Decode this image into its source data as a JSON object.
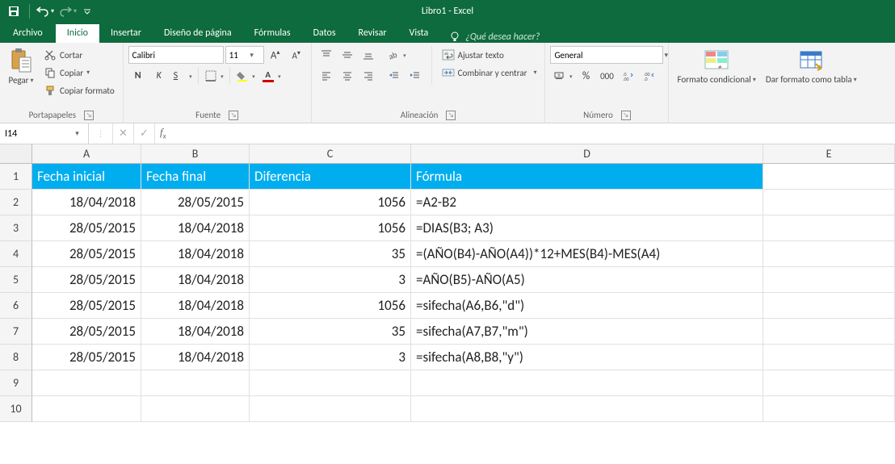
{
  "titlebar": {
    "title": "Libro1 - Excel"
  },
  "tabs": {
    "file": "Archivo",
    "items": [
      "Inicio",
      "Insertar",
      "Diseño de página",
      "Fórmulas",
      "Datos",
      "Revisar",
      "Vista"
    ],
    "active": 0,
    "tellme_placeholder": "¿Qué desea hacer?"
  },
  "ribbon": {
    "clipboard": {
      "label": "Portapapeles",
      "paste": "Pegar",
      "cut": "Cortar",
      "copy": "Copiar",
      "format_painter": "Copiar formato"
    },
    "font": {
      "label": "Fuente",
      "name": "Calibri",
      "size": "11",
      "bold": "N",
      "italic": "K",
      "underline": "S"
    },
    "alignment": {
      "label": "Alineación",
      "wrap": "Ajustar texto",
      "merge": "Combinar y centrar"
    },
    "number": {
      "label": "Número",
      "format": "General"
    },
    "styles": {
      "conditional": "Formato condicional",
      "table": "Dar formato como tabla"
    }
  },
  "namebox": {
    "value": "I14"
  },
  "sheet": {
    "columns": [
      "A",
      "B",
      "C",
      "D",
      "E"
    ],
    "header_row": [
      "Fecha inicial",
      "Fecha final",
      "Diferencia",
      "Fórmula",
      ""
    ],
    "rows": [
      {
        "n": "2",
        "A": "18/04/2018",
        "B": "28/05/2015",
        "C": "1056",
        "D": "=A2-B2"
      },
      {
        "n": "3",
        "A": "28/05/2015",
        "B": "18/04/2018",
        "C": "1056",
        "D": "=DIAS(B3; A3)"
      },
      {
        "n": "4",
        "A": "28/05/2015",
        "B": "18/04/2018",
        "C": "35",
        "D": "=(AÑO(B4)-AÑO(A4))*12+MES(B4)-MES(A4)"
      },
      {
        "n": "5",
        "A": "28/05/2015",
        "B": "18/04/2018",
        "C": "3",
        "D": "=AÑO(B5)-AÑO(A5)"
      },
      {
        "n": "6",
        "A": "28/05/2015",
        "B": "18/04/2018",
        "C": "1056",
        "D": "=sifecha(A6,B6,\"d\")"
      },
      {
        "n": "7",
        "A": "28/05/2015",
        "B": "18/04/2018",
        "C": "35",
        "D": "=sifecha(A7,B7,\"m\")"
      },
      {
        "n": "8",
        "A": "28/05/2015",
        "B": "18/04/2018",
        "C": "3",
        "D": "=sifecha(A8,B8,\"y\")"
      },
      {
        "n": "9",
        "A": "",
        "B": "",
        "C": "",
        "D": ""
      },
      {
        "n": "10",
        "A": "",
        "B": "",
        "C": "",
        "D": ""
      }
    ]
  }
}
